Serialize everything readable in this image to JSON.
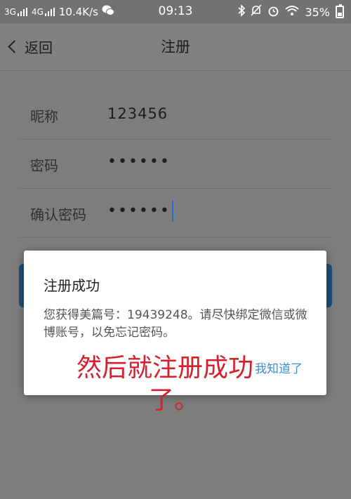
{
  "status_bar": {
    "network1": "3G",
    "network2": "4G",
    "speed": "10.4K/s",
    "time": "09:13",
    "battery": "35%"
  },
  "nav": {
    "back_label": "返回",
    "title": "注册"
  },
  "form": {
    "nickname_label": "昵称",
    "nickname_value": "123456",
    "password_label": "密码",
    "password_value": "••••••",
    "confirm_label": "确认密码",
    "confirm_value": "••••••"
  },
  "dialog": {
    "title": "注册成功",
    "message": "您获得美篇号：19439248。请尽快绑定微信或微博账号，以免忘记密码。",
    "ok_label": "我知道了"
  },
  "annotation": {
    "line1": "然后就注册成功",
    "line2": "了。"
  }
}
